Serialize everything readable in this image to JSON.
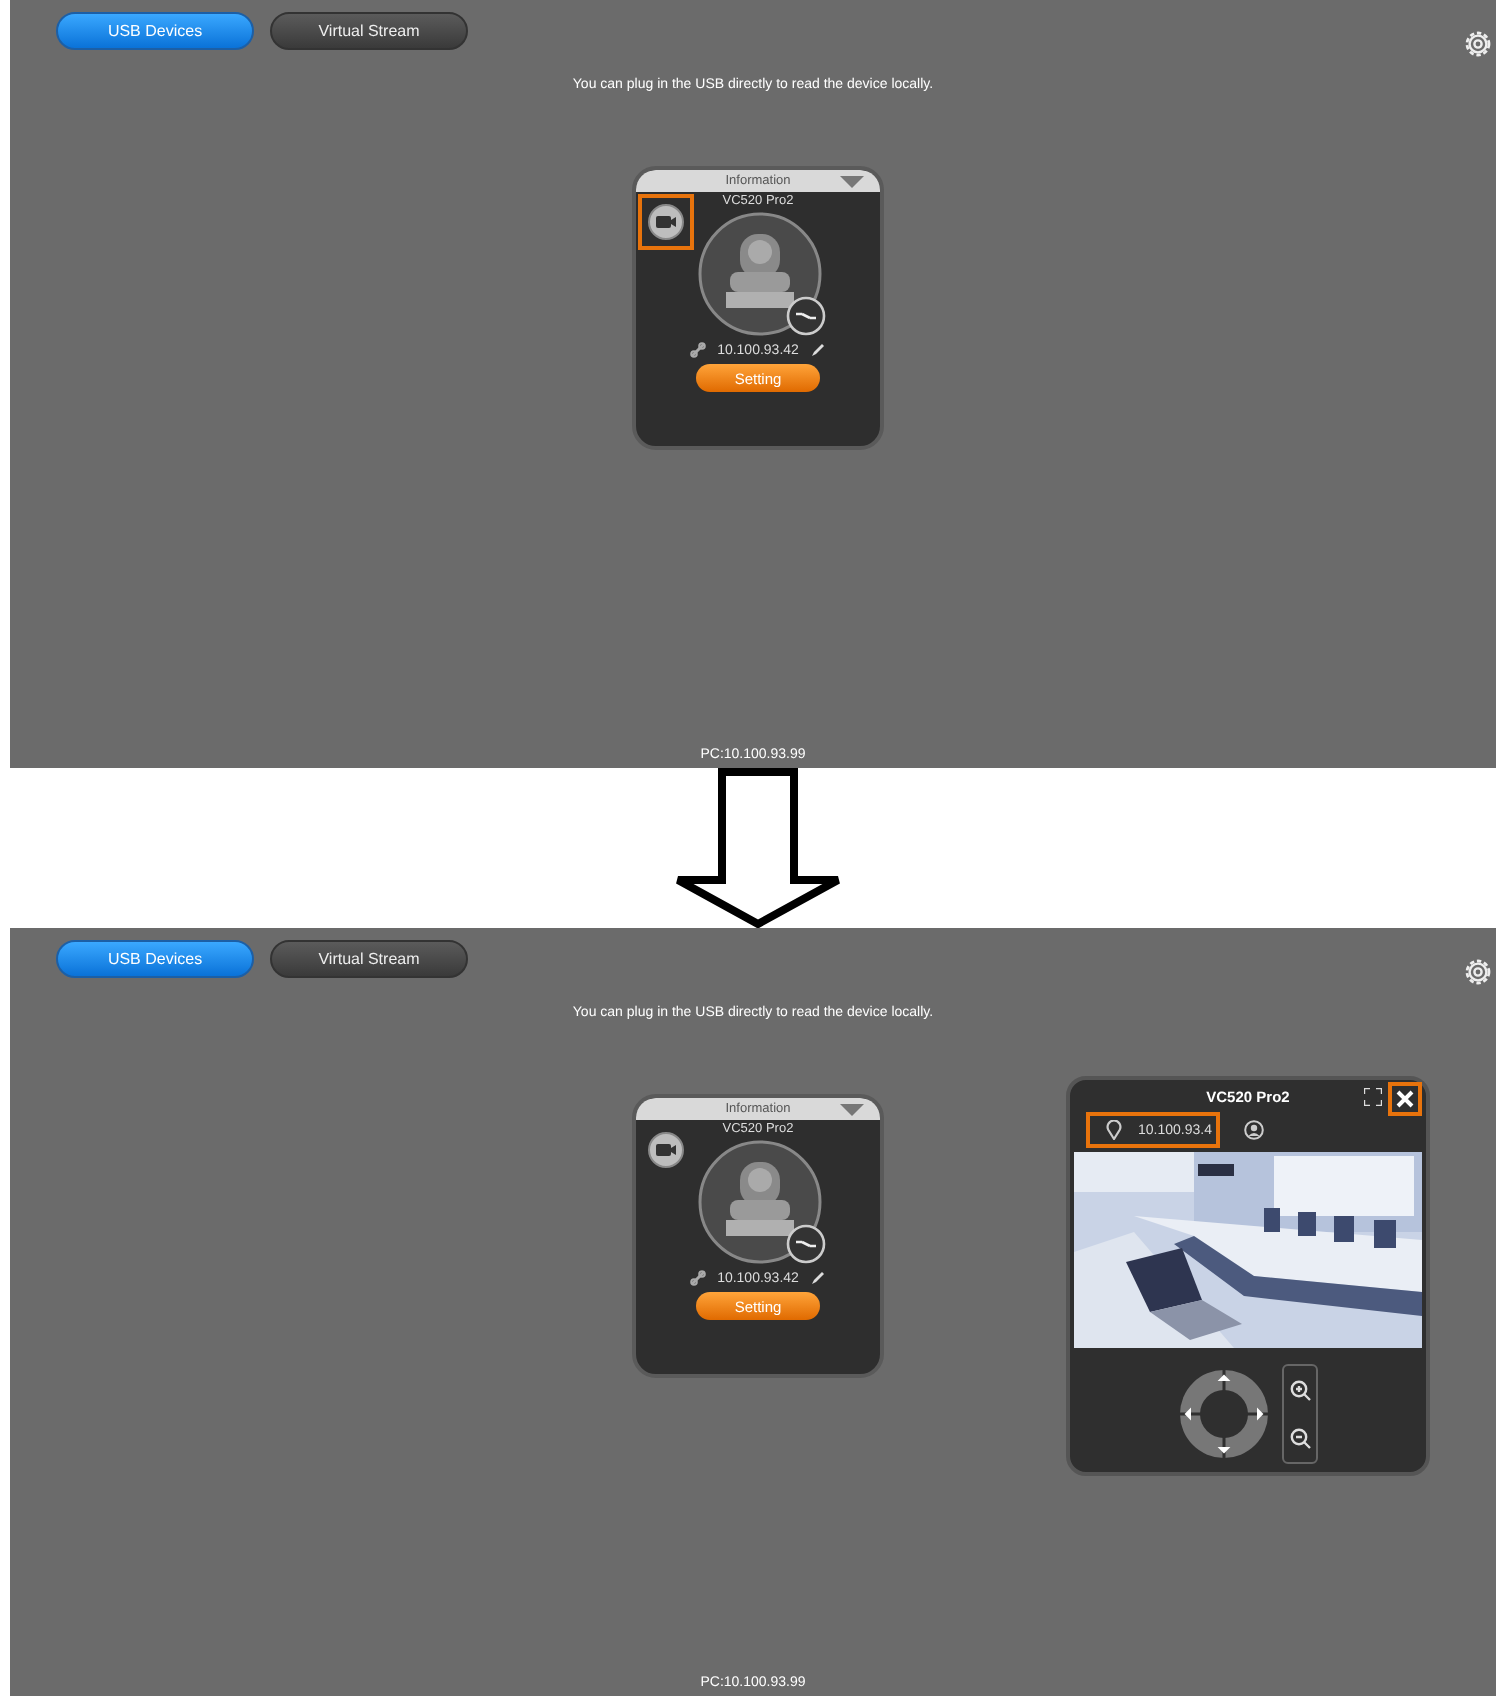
{
  "screens": [
    {
      "tabs": [
        {
          "label": "USB Devices",
          "selected": true
        },
        {
          "label": "Virtual Stream",
          "selected": false
        }
      ],
      "message": "You can plug in the USB directly to read the device locally.",
      "device_card": {
        "header": "Information",
        "name": "VC520 Pro2",
        "ip": "10.100.93.42",
        "button": "Setting",
        "camera_highlighted": true
      },
      "footer": "PC:10.100.93.99"
    },
    {
      "tabs": [
        {
          "label": "USB Devices",
          "selected": true
        },
        {
          "label": "Virtual Stream",
          "selected": false
        }
      ],
      "message": "You can plug in the USB directly to read the device locally.",
      "device_card": {
        "header": "Information",
        "name": "VC520 Pro2",
        "ip": "10.100.93.42",
        "button": "Setting",
        "camera_highlighted": false
      },
      "viewer": {
        "title": "VC520 Pro2",
        "ip": "10.100.93.4",
        "ip_highlighted": true,
        "close_highlighted": true
      },
      "footer": "PC:10.100.93.99"
    }
  ]
}
